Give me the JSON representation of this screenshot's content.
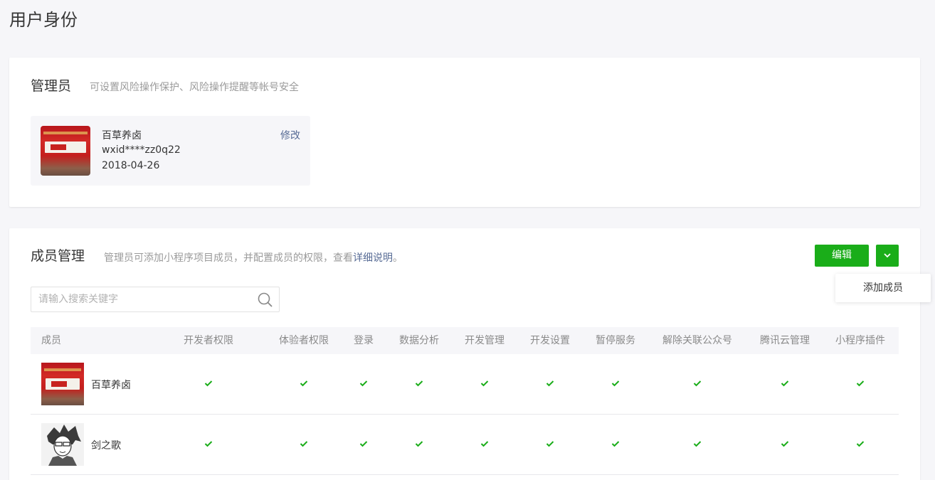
{
  "page": {
    "title": "用户身份"
  },
  "admin_section": {
    "title": "管理员",
    "description": "可设置风险操作保护、风险操作提醒等帐号安全",
    "admin": {
      "name": "百草养卤",
      "wechat_id": "wxid****zz0q22",
      "date": "2018-04-26",
      "modify_label": "修改"
    }
  },
  "members_section": {
    "title": "成员管理",
    "description_prefix": "管理员可添加小程序项目成员，并配置成员的权限，查看",
    "description_link": "详细说明",
    "description_suffix": "。",
    "edit_label": "编辑",
    "dropdown_items": [
      "添加成员"
    ],
    "search": {
      "placeholder": "请输入搜索关键字",
      "value": ""
    },
    "columns": [
      "成员",
      "开发者权限",
      "体验者权限",
      "登录",
      "数据分析",
      "开发管理",
      "开发设置",
      "暂停服务",
      "解除关联公众号",
      "腾讯云管理",
      "小程序插件"
    ],
    "members": [
      {
        "name": "百草养卤",
        "avatar": "red-banner-avatar",
        "permissions": [
          true,
          true,
          true,
          true,
          true,
          true,
          true,
          true,
          true,
          true
        ]
      },
      {
        "name": "剑之歌",
        "avatar": "sketch-portrait-avatar",
        "permissions": [
          true,
          true,
          true,
          true,
          true,
          true,
          true,
          true,
          true,
          true
        ]
      }
    ]
  },
  "colors": {
    "primary_green": "#1aad19",
    "link_blue": "#576b95",
    "check_green": "#1aad19"
  },
  "icons": {
    "search": "search-icon",
    "dropdown": "chevron-down-icon",
    "check": "check-icon"
  }
}
